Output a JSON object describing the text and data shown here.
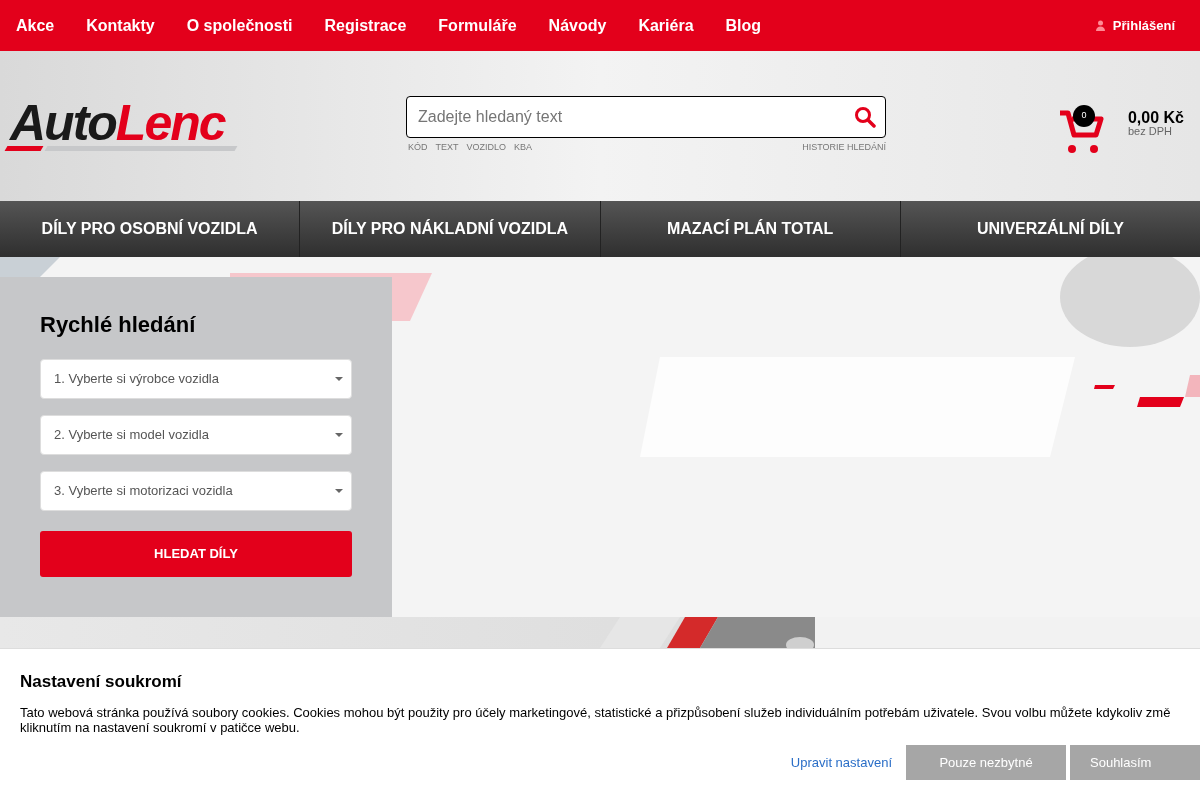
{
  "top_menu": [
    "Akce",
    "Kontakty",
    "O společnosti",
    "Registrace",
    "Formuláře",
    "Návody",
    "Kariéra",
    "Blog"
  ],
  "login": "Přihlášení",
  "logo": {
    "part_1": "Auto",
    "part_2": "Lenc"
  },
  "search": {
    "placeholder": "Zadejte hledaný text",
    "modes": [
      "KÓD",
      "TEXT",
      "VOZIDLO",
      "KBA"
    ],
    "history": "HISTORIE HLEDÁNÍ"
  },
  "cart": {
    "count": "0",
    "price": "0,00 Kč",
    "note": "bez DPH"
  },
  "categories": [
    "DÍLY PRO OSOBNÍ VOZIDLA",
    "DÍLY PRO NÁKLADNÍ VOZIDLA",
    "MAZACÍ PLÁN TOTAL",
    "UNIVERZÁLNÍ DÍLY"
  ],
  "quick_search": {
    "title": "Rychlé hledání",
    "selects": [
      "1. Vyberte si výrobce vozidla",
      "2. Vyberte si model vozidla",
      "3. Vyberte si motorizaci vozidla"
    ],
    "button": "HLEDAT DÍLY"
  },
  "cookies": {
    "title": "Nastavení soukromí",
    "line_1": "Tato webová stránka používá soubory cookies. Cookies mohou být použity pro účely marketingové, statistické a přizpůsobení služeb individuálním potřebám uživatele. Svou volbu můžete kdykoliv změ",
    "line_2": "kliknutím na nastavení soukromí v patičce webu.",
    "settings_link": "Upravit nastavení",
    "buttons": [
      "Pouze nezbytné",
      "Souhlasím"
    ]
  }
}
